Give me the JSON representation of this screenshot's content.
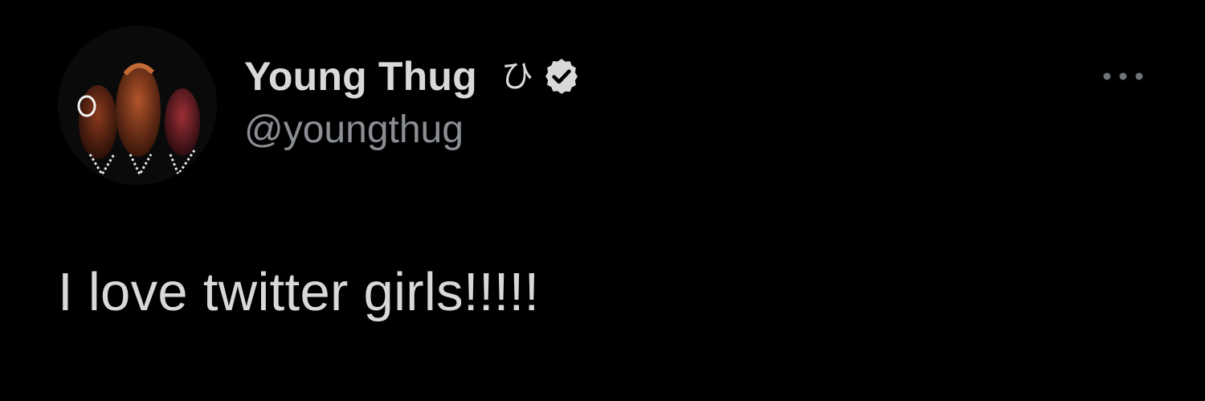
{
  "tweet": {
    "author": {
      "display_name": "Young Thug",
      "name_glyph": "ひ",
      "handle": "@youngthug",
      "verified": true,
      "avatar_icon": "group-photo-avatar"
    },
    "text": "I love twitter girls!!!!!",
    "more_icon": "more-horizontal-icon"
  },
  "colors": {
    "background": "#000000",
    "name": "#d9d9d9",
    "handle": "#8b8f94",
    "text": "#d8d8d8",
    "verified_badge": "#d9d9d9"
  }
}
